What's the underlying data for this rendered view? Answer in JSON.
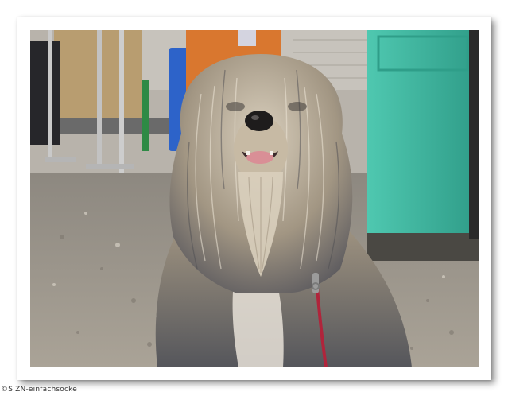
{
  "photo": {
    "subject": "",
    "colors": {
      "frame": "#ffffff",
      "ground": "#a39c90",
      "teal_door": "#3fb7a0",
      "blue_barrel": "#2d63c9",
      "orange_panel": "#d9772f",
      "fur_light": "#d8cdbb",
      "fur_dark": "#5a5a5e",
      "leash": "#b0243b"
    }
  },
  "watermark": {
    "text": "©S.ZN-einfachsocke"
  }
}
